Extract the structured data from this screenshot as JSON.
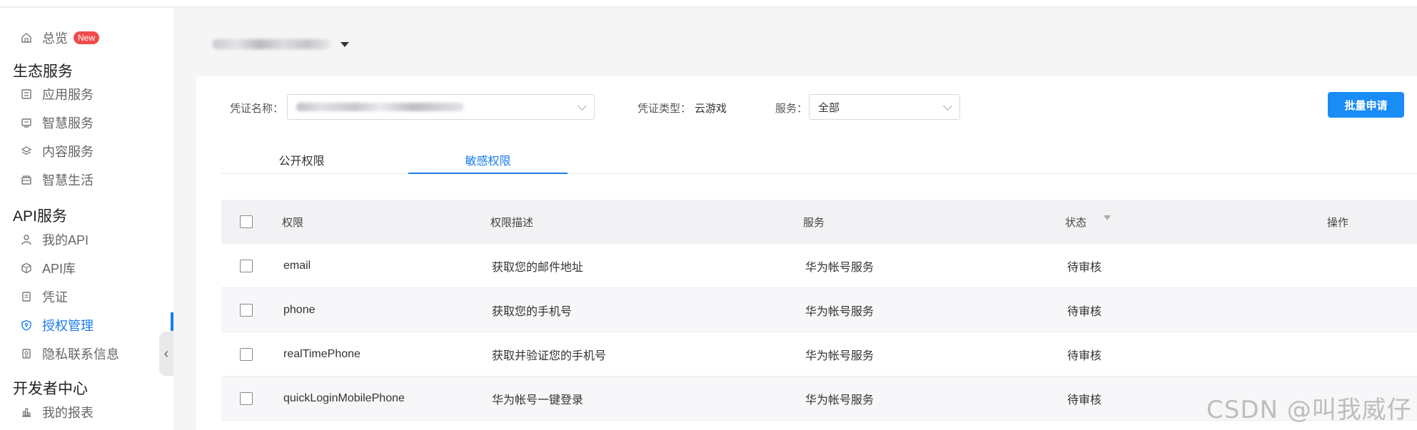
{
  "sidebar": {
    "overview": {
      "label": "总览",
      "badge": "New"
    },
    "groups": [
      {
        "title": "生态服务",
        "items": [
          "应用服务",
          "智慧服务",
          "内容服务",
          "智慧生活"
        ]
      },
      {
        "title": "API服务",
        "items": [
          "我的API",
          "API库",
          "凭证",
          "授权管理",
          "隐私联系信息"
        ]
      },
      {
        "title": "开发者中心",
        "items": [
          "我的报表"
        ]
      }
    ],
    "active_item": "授权管理",
    "collapse_glyph": "‹"
  },
  "header": {
    "app_selector_icon": "caret-down-icon"
  },
  "filters": {
    "credential_name_label": "凭证名称：",
    "credential_type_label": "凭证类型：",
    "credential_type_value": "云游戏",
    "service_label": "服务：",
    "service_value": "全部",
    "batch_apply_label": "批量申请"
  },
  "tabs": [
    {
      "label": "公开权限",
      "active": false
    },
    {
      "label": "敏感权限",
      "active": true
    }
  ],
  "table": {
    "columns": [
      "权限",
      "权限描述",
      "服务",
      "状态",
      "操作"
    ],
    "rows": [
      {
        "permission": "email",
        "description": "获取您的邮件地址",
        "service": "华为帐号服务",
        "status": "待审核"
      },
      {
        "permission": "phone",
        "description": "获取您的手机号",
        "service": "华为帐号服务",
        "status": "待审核"
      },
      {
        "permission": "realTimePhone",
        "description": "获取并验证您的手机号",
        "service": "华为帐号服务",
        "status": "待审核"
      },
      {
        "permission": "quickLoginMobilePhone",
        "description": "华为帐号一键登录",
        "service": "华为帐号服务",
        "status": "待审核"
      }
    ]
  },
  "watermark": "CSDN @叫我威仔",
  "colors": {
    "accent": "#1a7cf0",
    "primary_button": "#1a8cf5",
    "badge": "#f04b4b"
  }
}
